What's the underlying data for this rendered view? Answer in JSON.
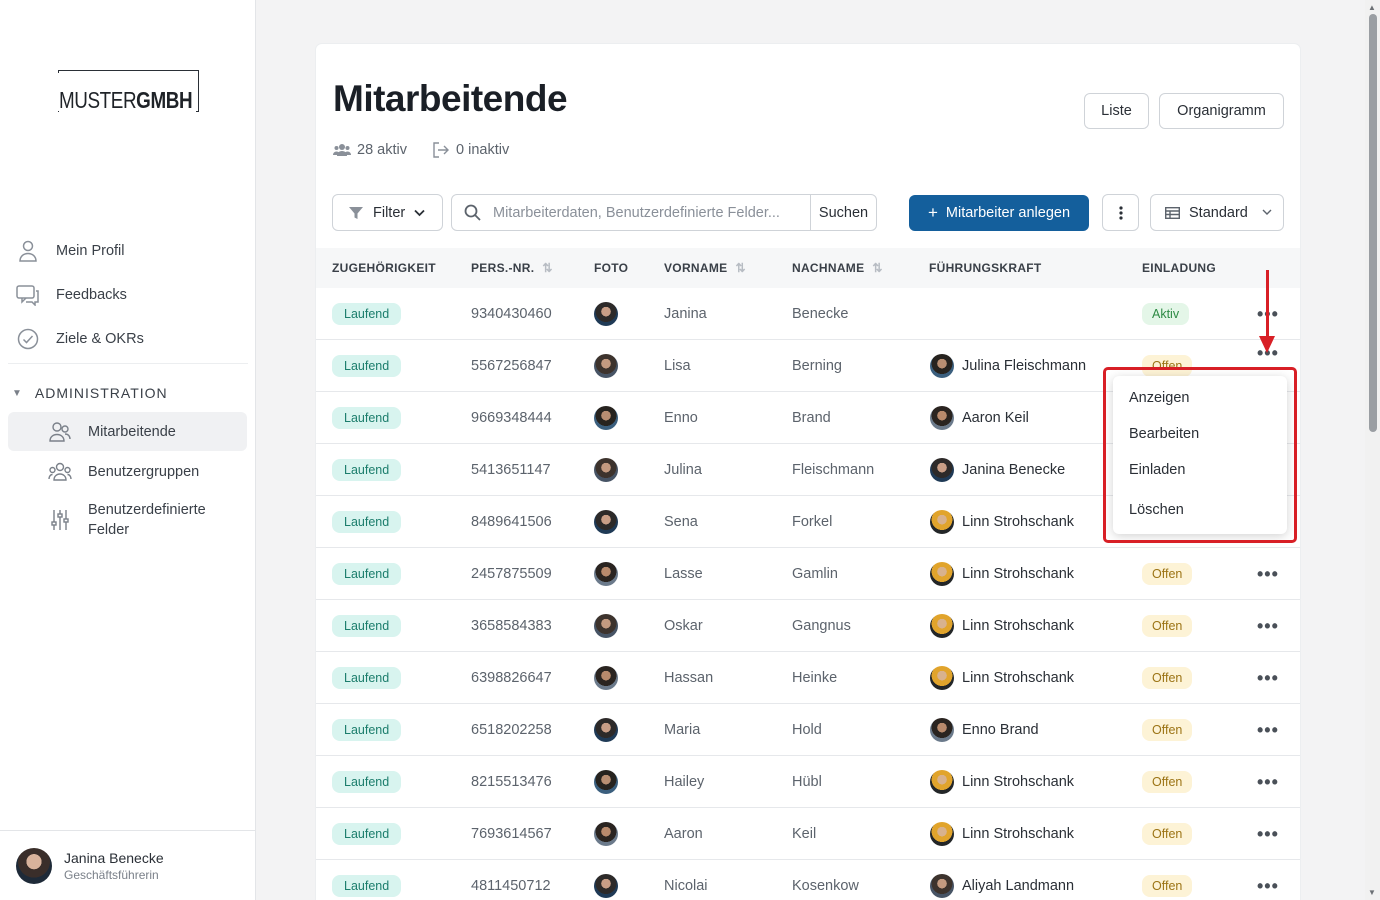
{
  "brand": {
    "logo_light": "MUSTER",
    "logo_bold": "GMBH"
  },
  "sidebar": {
    "items": [
      {
        "label": "Mein Profil",
        "icon": "user-icon"
      },
      {
        "label": "Feedbacks",
        "icon": "chat-icon"
      },
      {
        "label": "Ziele & OKRs",
        "icon": "check-circle-icon"
      }
    ],
    "section_title": "ADMINISTRATION",
    "sub_items": [
      {
        "label": "Mitarbeitende",
        "icon": "users-icon",
        "active": true
      },
      {
        "label": "Benutzergruppen",
        "icon": "groups-icon"
      },
      {
        "label": "Benutzerdefinierte Felder",
        "icon": "sliders-icon"
      }
    ],
    "user": {
      "name": "Janina Benecke",
      "role": "Geschäftsführerin"
    }
  },
  "header": {
    "title": "Mitarbeitende",
    "active_count": "28 aktiv",
    "inactive_count": "0 inaktiv",
    "view_list": "Liste",
    "view_org": "Organigramm"
  },
  "toolbar": {
    "filter_label": "Filter",
    "search_placeholder": "Mitarbeiterdaten, Benutzerdefinierte Felder...",
    "search_button": "Suchen",
    "add_button": "Mitarbeiter anlegen",
    "view_select": "Standard"
  },
  "table": {
    "columns": [
      "ZUGEHÖRIGKEIT",
      "PERS.-NR.",
      "FOTO",
      "VORNAME",
      "NACHNAME",
      "FÜHRUNGSKRAFT",
      "EINLADUNG"
    ],
    "rows": [
      {
        "status": "Laufend",
        "nr": "9340430460",
        "first": "Janina",
        "last": "Benecke",
        "leader": "",
        "invite": "Aktiv"
      },
      {
        "status": "Laufend",
        "nr": "5567256847",
        "first": "Lisa",
        "last": "Berning",
        "leader": "Julina Fleischmann",
        "invite": "Offen"
      },
      {
        "status": "Laufend",
        "nr": "9669348444",
        "first": "Enno",
        "last": "Brand",
        "leader": "Aaron Keil",
        "invite": ""
      },
      {
        "status": "Laufend",
        "nr": "5413651147",
        "first": "Julina",
        "last": "Fleischmann",
        "leader": "Janina Benecke",
        "invite": ""
      },
      {
        "status": "Laufend",
        "nr": "8489641506",
        "first": "Sena",
        "last": "Forkel",
        "leader": "Linn Strohschank",
        "invite": ""
      },
      {
        "status": "Laufend",
        "nr": "2457875509",
        "first": "Lasse",
        "last": "Gamlin",
        "leader": "Linn Strohschank",
        "invite": "Offen"
      },
      {
        "status": "Laufend",
        "nr": "3658584383",
        "first": "Oskar",
        "last": "Gangnus",
        "leader": "Linn Strohschank",
        "invite": "Offen"
      },
      {
        "status": "Laufend",
        "nr": "6398826647",
        "first": "Hassan",
        "last": "Heinke",
        "leader": "Linn Strohschank",
        "invite": "Offen"
      },
      {
        "status": "Laufend",
        "nr": "6518202258",
        "first": "Maria",
        "last": "Hold",
        "leader": "Enno Brand",
        "invite": "Offen"
      },
      {
        "status": "Laufend",
        "nr": "8215513476",
        "first": "Hailey",
        "last": "Hübl",
        "leader": "Linn Strohschank",
        "invite": "Offen"
      },
      {
        "status": "Laufend",
        "nr": "7693614567",
        "first": "Aaron",
        "last": "Keil",
        "leader": "Linn Strohschank",
        "invite": "Offen"
      },
      {
        "status": "Laufend",
        "nr": "4811450712",
        "first": "Nicolai",
        "last": "Kosenkow",
        "leader": "Aliyah Landmann",
        "invite": "Offen"
      }
    ]
  },
  "dropdown": {
    "items": [
      "Anzeigen",
      "Bearbeiten",
      "Einladen",
      "Löschen"
    ]
  },
  "colors": {
    "primary": "#145f9c",
    "annotation": "#d81f26",
    "badge_laufend": "#d8f4ef",
    "badge_offen": "#fdf3d6",
    "badge_aktiv": "#e4f6e8"
  }
}
